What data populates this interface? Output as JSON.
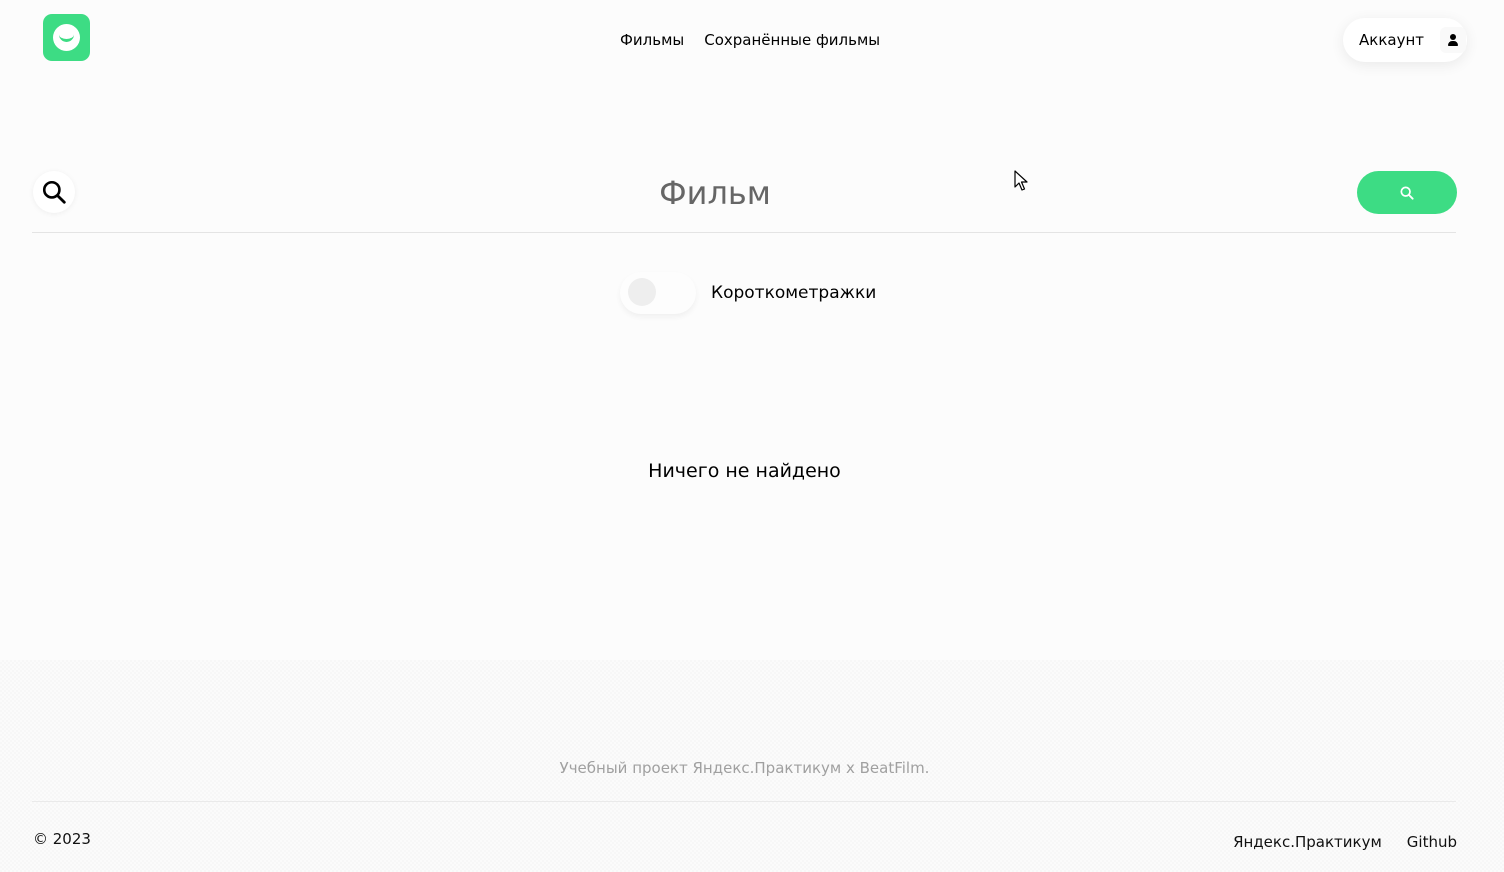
{
  "header": {
    "nav": {
      "movies": "Фильмы",
      "saved_movies": "Сохранённые фильмы"
    },
    "account_label": "Аккаунт"
  },
  "search": {
    "placeholder": "Фильм",
    "value": ""
  },
  "filter": {
    "shorts_label": "Короткометражки",
    "shorts_enabled": false
  },
  "results": {
    "empty_message": "Ничего не найдено"
  },
  "footer": {
    "note": "Учебный проект Яндекс.Практикум х BeatFilm.",
    "copyright": "© 2023",
    "links": {
      "practicum": "Яндекс.Практикум",
      "github": "Github"
    }
  },
  "colors": {
    "accent": "#3ddc84",
    "background": "#fcfcfc"
  }
}
